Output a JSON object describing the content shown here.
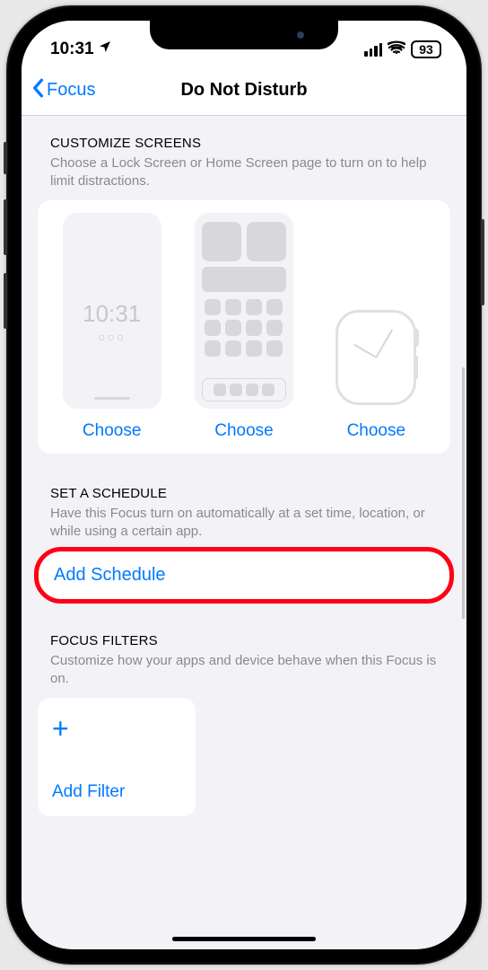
{
  "status": {
    "time": "10:31",
    "battery": "93"
  },
  "nav": {
    "back": "Focus",
    "title": "Do Not Disturb"
  },
  "customize": {
    "header": "CUSTOMIZE SCREENS",
    "desc": "Choose a Lock Screen or Home Screen page to turn on to help limit distractions.",
    "lock_time": "10:31",
    "lock_dots": "○○○",
    "choose1": "Choose",
    "choose2": "Choose",
    "choose3": "Choose"
  },
  "schedule": {
    "header": "SET A SCHEDULE",
    "desc": "Have this Focus turn on automatically at a set time, location, or while using a certain app.",
    "add": "Add Schedule"
  },
  "filters": {
    "header": "FOCUS FILTERS",
    "desc": "Customize how your apps and device behave when this Focus is on.",
    "add": "Add Filter"
  },
  "colors": {
    "accent": "#007aff",
    "highlight": "#ff0015"
  }
}
